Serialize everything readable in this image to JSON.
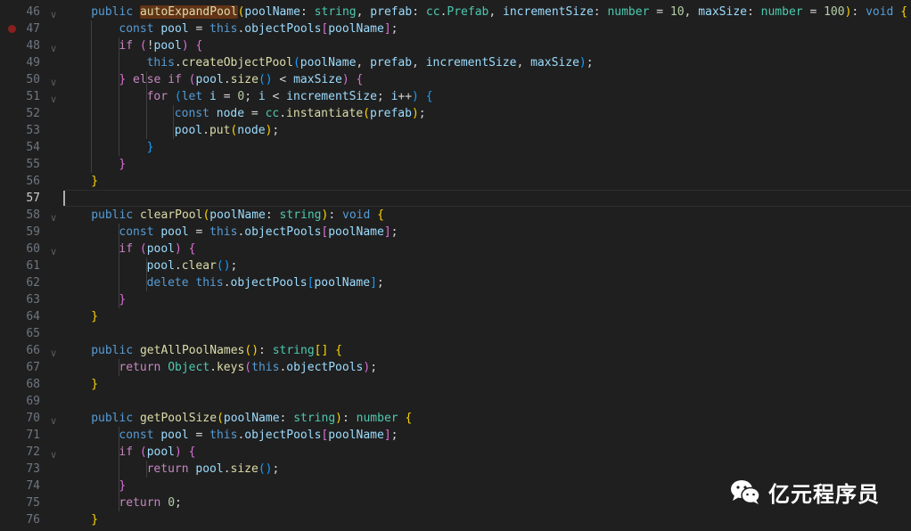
{
  "editor": {
    "current_line": 57,
    "breakpoint_line": 47,
    "lines": [
      {
        "n": "46",
        "fold": true,
        "tokens": [
          [
            "i",
            4
          ],
          [
            "kw",
            "public"
          ],
          [
            "p",
            " "
          ],
          [
            "hl",
            "autoExpandPool"
          ],
          [
            "b1",
            "("
          ],
          [
            "var",
            "poolName"
          ],
          [
            "p",
            ": "
          ],
          [
            "type",
            "string"
          ],
          [
            "p",
            ", "
          ],
          [
            "var",
            "prefab"
          ],
          [
            "p",
            ": "
          ],
          [
            "type",
            "cc"
          ],
          [
            "p",
            "."
          ],
          [
            "type",
            "Prefab"
          ],
          [
            "p",
            ", "
          ],
          [
            "var",
            "incrementSize"
          ],
          [
            "p",
            ": "
          ],
          [
            "type",
            "number"
          ],
          [
            "p",
            " = "
          ],
          [
            "num",
            "10"
          ],
          [
            "p",
            ", "
          ],
          [
            "var",
            "maxSize"
          ],
          [
            "p",
            ": "
          ],
          [
            "type",
            "number"
          ],
          [
            "p",
            " = "
          ],
          [
            "num",
            "100"
          ],
          [
            "b1",
            ")"
          ],
          [
            "p",
            ": "
          ],
          [
            "kw",
            "void"
          ],
          [
            "p",
            " "
          ],
          [
            "b1",
            "{"
          ]
        ]
      },
      {
        "n": "47",
        "fold": false,
        "tokens": [
          [
            "i",
            8
          ],
          [
            "kw",
            "const"
          ],
          [
            "p",
            " "
          ],
          [
            "var",
            "pool"
          ],
          [
            "p",
            " = "
          ],
          [
            "kw",
            "this"
          ],
          [
            "p",
            "."
          ],
          [
            "var",
            "objectPools"
          ],
          [
            "b2",
            "["
          ],
          [
            "var",
            "poolName"
          ],
          [
            "b2",
            "]"
          ],
          [
            "p",
            ";"
          ]
        ]
      },
      {
        "n": "48",
        "fold": true,
        "tokens": [
          [
            "i",
            8
          ],
          [
            "ctl",
            "if"
          ],
          [
            "p",
            " "
          ],
          [
            "b2",
            "("
          ],
          [
            "p",
            "!"
          ],
          [
            "var",
            "pool"
          ],
          [
            "b2",
            ")"
          ],
          [
            "p",
            " "
          ],
          [
            "b2",
            "{"
          ]
        ]
      },
      {
        "n": "49",
        "fold": false,
        "tokens": [
          [
            "i",
            12
          ],
          [
            "kw",
            "this"
          ],
          [
            "p",
            "."
          ],
          [
            "fn",
            "createObjectPool"
          ],
          [
            "b3",
            "("
          ],
          [
            "var",
            "poolName"
          ],
          [
            "p",
            ", "
          ],
          [
            "var",
            "prefab"
          ],
          [
            "p",
            ", "
          ],
          [
            "var",
            "incrementSize"
          ],
          [
            "p",
            ", "
          ],
          [
            "var",
            "maxSize"
          ],
          [
            "b3",
            ")"
          ],
          [
            "p",
            ";"
          ]
        ]
      },
      {
        "n": "50",
        "fold": true,
        "tokens": [
          [
            "i",
            8
          ],
          [
            "b2",
            "}"
          ],
          [
            "p",
            " "
          ],
          [
            "ctl",
            "else"
          ],
          [
            "p",
            " "
          ],
          [
            "ctl",
            "if"
          ],
          [
            "p",
            " "
          ],
          [
            "b2",
            "("
          ],
          [
            "var",
            "pool"
          ],
          [
            "p",
            "."
          ],
          [
            "fn",
            "size"
          ],
          [
            "b3",
            "()"
          ],
          [
            "p",
            " < "
          ],
          [
            "var",
            "maxSize"
          ],
          [
            "b2",
            ")"
          ],
          [
            "p",
            " "
          ],
          [
            "b2",
            "{"
          ]
        ]
      },
      {
        "n": "51",
        "fold": true,
        "tokens": [
          [
            "i",
            12
          ],
          [
            "ctl",
            "for"
          ],
          [
            "p",
            " "
          ],
          [
            "b3",
            "("
          ],
          [
            "kw",
            "let"
          ],
          [
            "p",
            " "
          ],
          [
            "var",
            "i"
          ],
          [
            "p",
            " = "
          ],
          [
            "num",
            "0"
          ],
          [
            "p",
            "; "
          ],
          [
            "var",
            "i"
          ],
          [
            "p",
            " < "
          ],
          [
            "var",
            "incrementSize"
          ],
          [
            "p",
            "; "
          ],
          [
            "var",
            "i"
          ],
          [
            "p",
            "++"
          ],
          [
            "b3",
            ")"
          ],
          [
            "p",
            " "
          ],
          [
            "b3",
            "{"
          ]
        ]
      },
      {
        "n": "52",
        "fold": false,
        "tokens": [
          [
            "i",
            16
          ],
          [
            "kw",
            "const"
          ],
          [
            "p",
            " "
          ],
          [
            "var",
            "node"
          ],
          [
            "p",
            " = "
          ],
          [
            "type",
            "cc"
          ],
          [
            "p",
            "."
          ],
          [
            "fn",
            "instantiate"
          ],
          [
            "b1",
            "("
          ],
          [
            "var",
            "prefab"
          ],
          [
            "b1",
            ")"
          ],
          [
            "p",
            ";"
          ]
        ]
      },
      {
        "n": "53",
        "fold": false,
        "tokens": [
          [
            "i",
            16
          ],
          [
            "var",
            "pool"
          ],
          [
            "p",
            "."
          ],
          [
            "fn",
            "put"
          ],
          [
            "b1",
            "("
          ],
          [
            "var",
            "node"
          ],
          [
            "b1",
            ")"
          ],
          [
            "p",
            ";"
          ]
        ]
      },
      {
        "n": "54",
        "fold": false,
        "tokens": [
          [
            "i",
            12
          ],
          [
            "b3",
            "}"
          ]
        ]
      },
      {
        "n": "55",
        "fold": false,
        "tokens": [
          [
            "i",
            8
          ],
          [
            "b2",
            "}"
          ]
        ]
      },
      {
        "n": "56",
        "fold": false,
        "tokens": [
          [
            "i",
            4
          ],
          [
            "b1",
            "}"
          ]
        ]
      },
      {
        "n": "57",
        "fold": false,
        "tokens": []
      },
      {
        "n": "58",
        "fold": true,
        "tokens": [
          [
            "i",
            4
          ],
          [
            "kw",
            "public"
          ],
          [
            "p",
            " "
          ],
          [
            "fn",
            "clearPool"
          ],
          [
            "b1",
            "("
          ],
          [
            "var",
            "poolName"
          ],
          [
            "p",
            ": "
          ],
          [
            "type",
            "string"
          ],
          [
            "b1",
            ")"
          ],
          [
            "p",
            ": "
          ],
          [
            "kw",
            "void"
          ],
          [
            "p",
            " "
          ],
          [
            "b1",
            "{"
          ]
        ]
      },
      {
        "n": "59",
        "fold": false,
        "tokens": [
          [
            "i",
            8
          ],
          [
            "kw",
            "const"
          ],
          [
            "p",
            " "
          ],
          [
            "var",
            "pool"
          ],
          [
            "p",
            " = "
          ],
          [
            "kw",
            "this"
          ],
          [
            "p",
            "."
          ],
          [
            "var",
            "objectPools"
          ],
          [
            "b2",
            "["
          ],
          [
            "var",
            "poolName"
          ],
          [
            "b2",
            "]"
          ],
          [
            "p",
            ";"
          ]
        ]
      },
      {
        "n": "60",
        "fold": true,
        "tokens": [
          [
            "i",
            8
          ],
          [
            "ctl",
            "if"
          ],
          [
            "p",
            " "
          ],
          [
            "b2",
            "("
          ],
          [
            "var",
            "pool"
          ],
          [
            "b2",
            ")"
          ],
          [
            "p",
            " "
          ],
          [
            "b2",
            "{"
          ]
        ]
      },
      {
        "n": "61",
        "fold": false,
        "tokens": [
          [
            "i",
            12
          ],
          [
            "var",
            "pool"
          ],
          [
            "p",
            "."
          ],
          [
            "fn",
            "clear"
          ],
          [
            "b3",
            "()"
          ],
          [
            "p",
            ";"
          ]
        ]
      },
      {
        "n": "62",
        "fold": false,
        "tokens": [
          [
            "i",
            12
          ],
          [
            "kw",
            "delete"
          ],
          [
            "p",
            " "
          ],
          [
            "kw",
            "this"
          ],
          [
            "p",
            "."
          ],
          [
            "var",
            "objectPools"
          ],
          [
            "b3",
            "["
          ],
          [
            "var",
            "poolName"
          ],
          [
            "b3",
            "]"
          ],
          [
            "p",
            ";"
          ]
        ]
      },
      {
        "n": "63",
        "fold": false,
        "tokens": [
          [
            "i",
            8
          ],
          [
            "b2",
            "}"
          ]
        ]
      },
      {
        "n": "64",
        "fold": false,
        "tokens": [
          [
            "i",
            4
          ],
          [
            "b1",
            "}"
          ]
        ]
      },
      {
        "n": "65",
        "fold": false,
        "tokens": []
      },
      {
        "n": "66",
        "fold": true,
        "tokens": [
          [
            "i",
            4
          ],
          [
            "kw",
            "public"
          ],
          [
            "p",
            " "
          ],
          [
            "fn",
            "getAllPoolNames"
          ],
          [
            "b1",
            "()"
          ],
          [
            "p",
            ": "
          ],
          [
            "type",
            "string"
          ],
          [
            "b1",
            "[]"
          ],
          [
            "p",
            " "
          ],
          [
            "b1",
            "{"
          ]
        ]
      },
      {
        "n": "67",
        "fold": false,
        "tokens": [
          [
            "i",
            8
          ],
          [
            "ctl",
            "return"
          ],
          [
            "p",
            " "
          ],
          [
            "type",
            "Object"
          ],
          [
            "p",
            "."
          ],
          [
            "fn",
            "keys"
          ],
          [
            "b2",
            "("
          ],
          [
            "kw",
            "this"
          ],
          [
            "p",
            "."
          ],
          [
            "var",
            "objectPools"
          ],
          [
            "b2",
            ")"
          ],
          [
            "p",
            ";"
          ]
        ]
      },
      {
        "n": "68",
        "fold": false,
        "tokens": [
          [
            "i",
            4
          ],
          [
            "b1",
            "}"
          ]
        ]
      },
      {
        "n": "69",
        "fold": false,
        "tokens": []
      },
      {
        "n": "70",
        "fold": true,
        "tokens": [
          [
            "i",
            4
          ],
          [
            "kw",
            "public"
          ],
          [
            "p",
            " "
          ],
          [
            "fn",
            "getPoolSize"
          ],
          [
            "b1",
            "("
          ],
          [
            "var",
            "poolName"
          ],
          [
            "p",
            ": "
          ],
          [
            "type",
            "string"
          ],
          [
            "b1",
            ")"
          ],
          [
            "p",
            ": "
          ],
          [
            "type",
            "number"
          ],
          [
            "p",
            " "
          ],
          [
            "b1",
            "{"
          ]
        ]
      },
      {
        "n": "71",
        "fold": false,
        "tokens": [
          [
            "i",
            8
          ],
          [
            "kw",
            "const"
          ],
          [
            "p",
            " "
          ],
          [
            "var",
            "pool"
          ],
          [
            "p",
            " = "
          ],
          [
            "kw",
            "this"
          ],
          [
            "p",
            "."
          ],
          [
            "var",
            "objectPools"
          ],
          [
            "b2",
            "["
          ],
          [
            "var",
            "poolName"
          ],
          [
            "b2",
            "]"
          ],
          [
            "p",
            ";"
          ]
        ]
      },
      {
        "n": "72",
        "fold": true,
        "tokens": [
          [
            "i",
            8
          ],
          [
            "ctl",
            "if"
          ],
          [
            "p",
            " "
          ],
          [
            "b2",
            "("
          ],
          [
            "var",
            "pool"
          ],
          [
            "b2",
            ")"
          ],
          [
            "p",
            " "
          ],
          [
            "b2",
            "{"
          ]
        ]
      },
      {
        "n": "73",
        "fold": false,
        "tokens": [
          [
            "i",
            12
          ],
          [
            "ctl",
            "return"
          ],
          [
            "p",
            " "
          ],
          [
            "var",
            "pool"
          ],
          [
            "p",
            "."
          ],
          [
            "fn",
            "size"
          ],
          [
            "b3",
            "()"
          ],
          [
            "p",
            ";"
          ]
        ]
      },
      {
        "n": "74",
        "fold": false,
        "tokens": [
          [
            "i",
            8
          ],
          [
            "b2",
            "}"
          ]
        ]
      },
      {
        "n": "75",
        "fold": false,
        "tokens": [
          [
            "i",
            8
          ],
          [
            "ctl",
            "return"
          ],
          [
            "p",
            " "
          ],
          [
            "num",
            "0"
          ],
          [
            "p",
            ";"
          ]
        ]
      },
      {
        "n": "76",
        "fold": false,
        "tokens": [
          [
            "i",
            4
          ],
          [
            "b1",
            "}"
          ]
        ]
      }
    ]
  },
  "watermark": {
    "icon": "wechat-icon",
    "text": "亿元程序员"
  },
  "colors": {
    "background": "#1f1f1f",
    "keyword": "#569cd6",
    "control": "#c586c0",
    "function": "#dcdcaa",
    "variable": "#9cdcfe",
    "type": "#4ec9b0",
    "number": "#b5cea8",
    "bracket1": "#ffd700",
    "bracket2": "#da70d6",
    "bracket3": "#179fff"
  }
}
